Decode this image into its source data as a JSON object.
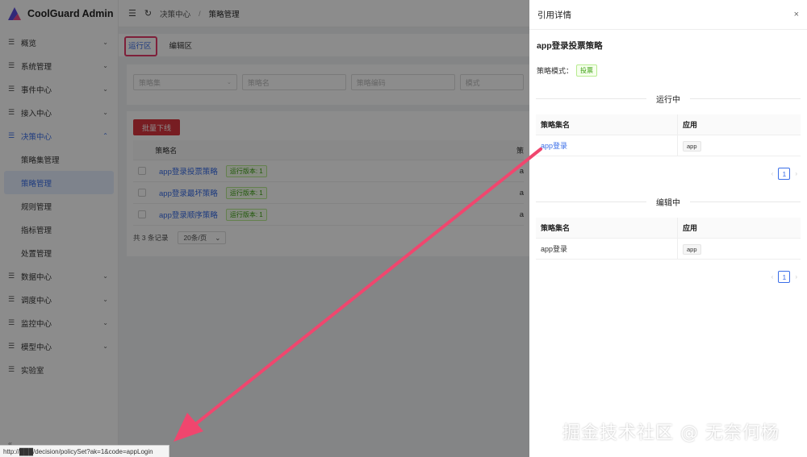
{
  "app": {
    "title": "CoolGuard Admin"
  },
  "sidebar": {
    "items": [
      {
        "label": "概览",
        "icon": "menu-icon",
        "chevron": "⌄"
      },
      {
        "label": "系统管理",
        "icon": "menu-icon",
        "chevron": "⌄"
      },
      {
        "label": "事件中心",
        "icon": "menu-icon",
        "chevron": "⌄"
      },
      {
        "label": "接入中心",
        "icon": "menu-icon",
        "chevron": "⌄"
      },
      {
        "label": "决策中心",
        "icon": "menu-icon",
        "chevron": "⌃",
        "expanded": true
      },
      {
        "label": "数据中心",
        "icon": "menu-icon",
        "chevron": "⌄"
      },
      {
        "label": "调度中心",
        "icon": "menu-icon",
        "chevron": "⌄"
      },
      {
        "label": "监控中心",
        "icon": "menu-icon",
        "chevron": "⌄"
      },
      {
        "label": "模型中心",
        "icon": "menu-icon",
        "chevron": "⌄"
      },
      {
        "label": "实验室",
        "icon": "menu-icon",
        "chevron": ""
      }
    ],
    "submenu": [
      "策略集管理",
      "策略管理",
      "规则管理",
      "指标管理",
      "处置管理"
    ],
    "selected_sub": "策略管理",
    "collapse": "«"
  },
  "header": {
    "breadcrumb": [
      "决策中心",
      "策略管理"
    ]
  },
  "tabs": [
    "运行区",
    "编辑区"
  ],
  "filters": [
    "策略集",
    "策略名",
    "策略编码",
    "模式"
  ],
  "list": {
    "batch_button": "批量下线",
    "col_name": "策略名",
    "col_cut": "策",
    "rows": [
      {
        "name": "app登录投票策略",
        "tag": "运行版本: 1",
        "trail": "a"
      },
      {
        "name": "app登录最坏策略",
        "tag": "运行版本: 1",
        "trail": "a"
      },
      {
        "name": "app登录顺序策略",
        "tag": "运行版本: 1",
        "trail": "a"
      }
    ],
    "total": "共 3 条记录",
    "page_size": "20条/页"
  },
  "drawer": {
    "title": "引用详情",
    "close": "×",
    "policy_name": "app登录投票策略",
    "mode_label": "策略模式：",
    "mode_value": "投票",
    "running": {
      "heading": "运行中",
      "col1": "策略集名",
      "col2": "应用",
      "rows": [
        {
          "name": "app登录",
          "app": "app"
        }
      ],
      "page": "1"
    },
    "editing": {
      "heading": "编辑中",
      "col1": "策略集名",
      "col2": "应用",
      "rows": [
        {
          "name": "app登录",
          "app": "app"
        }
      ],
      "page": "1"
    }
  },
  "statusbar": {
    "url": "http://███/decision/policySet?ak=1&code=appLogin"
  },
  "watermark": "掘金技术社区 @ 无奈何杨",
  "colors": {
    "primary": "#3a6ee8",
    "danger": "#d9363e",
    "annotation": "#f0466e"
  }
}
